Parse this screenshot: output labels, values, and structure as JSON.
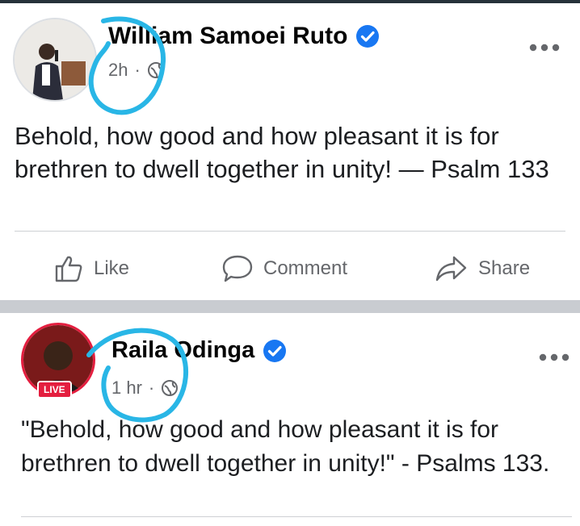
{
  "posts": [
    {
      "author": "William Samoei Ruto",
      "time": "2h",
      "separator": "·",
      "text": "Behold, how good and how pleasant it is for brethren to dwell together in unity! — Psalm 133",
      "actions": {
        "like": "Like",
        "comment": "Comment",
        "share": "Share"
      }
    },
    {
      "author": "Raila Odinga",
      "time": "1 hr",
      "separator": "·",
      "live_badge": "LIVE",
      "text": "\"Behold, how good and how pleasant it is for brethren to dwell together in unity!\" - Psalms 133."
    }
  ],
  "colors": {
    "verified": "#1877f2",
    "annotation_circle": "#29b6e6",
    "live": "#e41e3f",
    "secondary_text": "#65676b"
  },
  "icons": [
    "verified-badge-icon",
    "globe-icon",
    "more-options-icon",
    "like-icon",
    "comment-icon",
    "share-icon"
  ]
}
